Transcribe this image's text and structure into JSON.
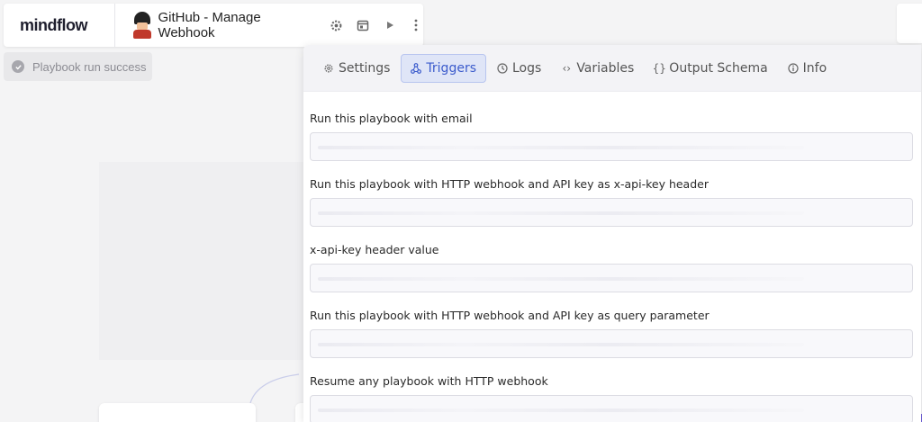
{
  "header": {
    "logo": "mindflow",
    "title": "GitHub - Manage Webhook",
    "icons": [
      "gear-icon",
      "calendar-icon",
      "play-icon",
      "more-vertical-icon"
    ]
  },
  "status": {
    "text": "Playbook run success",
    "icon": "check-circle-icon"
  },
  "tabs": [
    {
      "label": "Settings",
      "icon": "gear-icon",
      "active": false
    },
    {
      "label": "Triggers",
      "icon": "triggers-icon",
      "active": true
    },
    {
      "label": "Logs",
      "icon": "clock-icon",
      "active": false
    },
    {
      "label": "Variables",
      "icon": "code-icon",
      "active": false
    },
    {
      "label": "Output Schema",
      "icon": "braces-icon",
      "active": false
    },
    {
      "label": "Info",
      "icon": "info-icon",
      "active": false
    }
  ],
  "fields": [
    {
      "label": "Run this playbook with email",
      "value": ""
    },
    {
      "label": "Run this playbook with HTTP webhook and API key as x-api-key header",
      "value": ""
    },
    {
      "label": "x-api-key header value",
      "value": ""
    },
    {
      "label": "Run this playbook with HTTP webhook and API key as query parameter",
      "value": ""
    },
    {
      "label": "Resume any playbook with HTTP webhook",
      "value": ""
    }
  ],
  "colors": {
    "accent": "#3b5bcc",
    "active_tab_bg": "#dfe5f7",
    "brand_purple": "#6b5bd6"
  }
}
